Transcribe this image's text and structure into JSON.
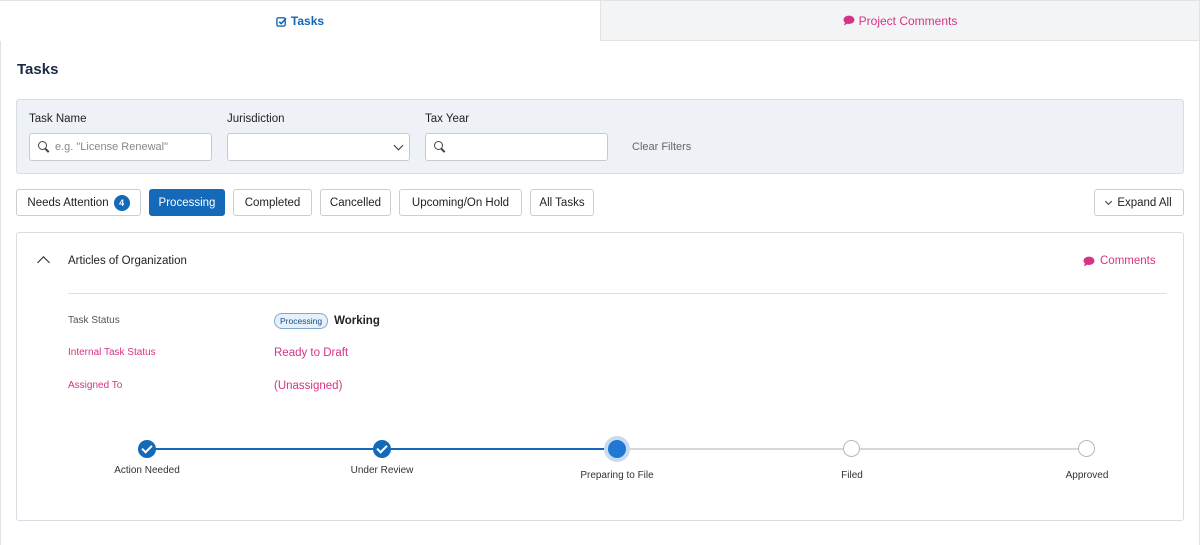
{
  "tabs": [
    {
      "label": "Tasks",
      "icon": "check-square-icon",
      "active": true
    },
    {
      "label": "Project Comments",
      "icon": "comment-icon",
      "active": false
    }
  ],
  "page_title": "Tasks",
  "filters": {
    "task_name_label": "Task Name",
    "task_name_placeholder": "e.g. \"License Renewal\"",
    "jurisdiction_label": "Jurisdiction",
    "jurisdiction_value": "",
    "tax_year_label": "Tax Year",
    "tax_year_value": "",
    "clear_label": "Clear Filters"
  },
  "status_buttons": [
    {
      "label": "Needs Attention",
      "count": "4",
      "active": false
    },
    {
      "label": "Processing",
      "active": true
    },
    {
      "label": "Completed",
      "active": false
    },
    {
      "label": "Cancelled",
      "active": false
    },
    {
      "label": "Upcoming/On Hold",
      "active": false
    },
    {
      "label": "All Tasks",
      "active": false
    }
  ],
  "expand_all_label": "Expand All",
  "task": {
    "title": "Articles of Organization",
    "comments_label": "Comments",
    "status_label": "Task Status",
    "status_pill": "Processing",
    "status_value": "Working",
    "internal_status_label": "Internal Task Status",
    "internal_status_value": "Ready to Draft",
    "assigned_label": "Assigned To",
    "assigned_value": "(Unassigned)",
    "steps": [
      {
        "label": "Action Needed",
        "state": "done"
      },
      {
        "label": "Under Review",
        "state": "done"
      },
      {
        "label": "Preparing to File",
        "state": "current"
      },
      {
        "label": "Filed",
        "state": "todo"
      },
      {
        "label": "Approved",
        "state": "todo"
      }
    ]
  },
  "colors": {
    "primary": "#1469b9",
    "accent_pink": "#d63384",
    "panel_bg": "#eef1f5"
  }
}
